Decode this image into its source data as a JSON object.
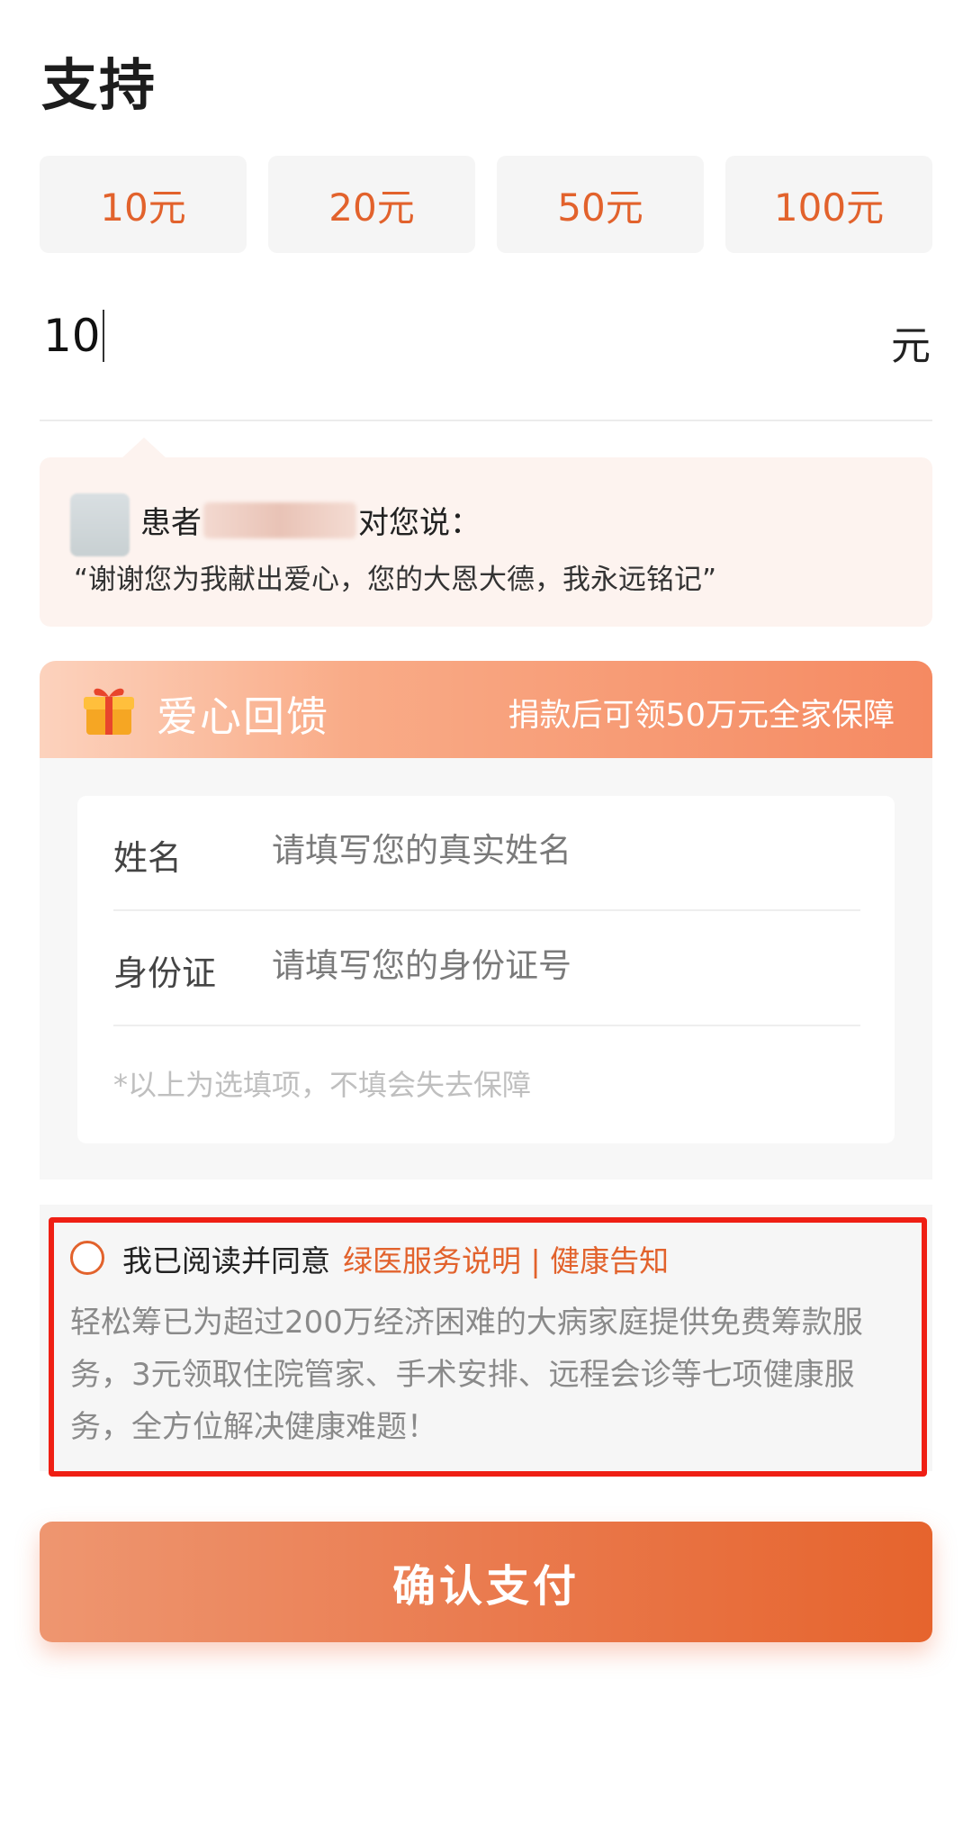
{
  "page": {
    "title": "支持"
  },
  "amount_options": [
    "10元",
    "20元",
    "50元",
    "100元"
  ],
  "amount_input": {
    "value": "10",
    "unit": "元"
  },
  "message": {
    "prefix": "患者",
    "suffix": "对您说：",
    "quote": "“谢谢您为我献出爱心，您的大恩大德，我永远铭记”"
  },
  "love_feedback": {
    "title": "爱心回馈",
    "subtitle": "捐款后可领50万元全家保障",
    "name_label": "姓名",
    "name_placeholder": "请填写您的真实姓名",
    "id_label": "身份证",
    "id_placeholder": "请填写您的身份证号",
    "note": "*以上为选填项，不填会失去保障"
  },
  "agreement": {
    "text": "我已阅读并同意",
    "links": "绿医服务说明 | 健康告知",
    "description": "轻松筹已为超过200万经济困难的大病家庭提供免费筹款服务，3元领取住院管家、手术安排、远程会诊等七项健康服务，全方位解决健康难题！"
  },
  "confirm_button": "确认支付",
  "colors": {
    "accent": "#e2622c",
    "highlight_frame": "#ef1f14"
  }
}
